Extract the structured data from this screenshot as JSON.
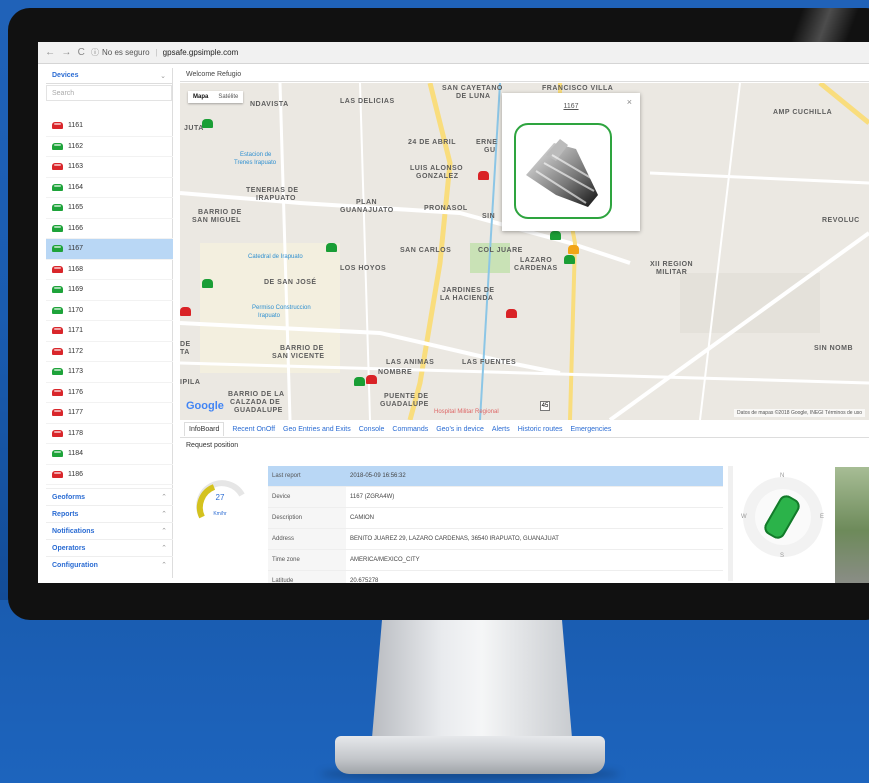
{
  "browser": {
    "security": "No es seguro",
    "url": "gpsafe.gpsimple.com"
  },
  "sidebar": {
    "devices_label": "Devices",
    "search_placeholder": "Search",
    "devices": [
      {
        "id": "1161",
        "status": "red"
      },
      {
        "id": "1162",
        "status": "green"
      },
      {
        "id": "1163",
        "status": "red"
      },
      {
        "id": "1164",
        "status": "green"
      },
      {
        "id": "1165",
        "status": "green"
      },
      {
        "id": "1166",
        "status": "green"
      },
      {
        "id": "1167",
        "status": "green",
        "selected": true
      },
      {
        "id": "1168",
        "status": "red"
      },
      {
        "id": "1169",
        "status": "green"
      },
      {
        "id": "1170",
        "status": "green"
      },
      {
        "id": "1171",
        "status": "red"
      },
      {
        "id": "1172",
        "status": "red"
      },
      {
        "id": "1173",
        "status": "green"
      },
      {
        "id": "1176",
        "status": "red"
      },
      {
        "id": "1177",
        "status": "red"
      },
      {
        "id": "1178",
        "status": "red"
      },
      {
        "id": "1184",
        "status": "green"
      },
      {
        "id": "1186",
        "status": "red"
      }
    ],
    "menu": [
      "Geoforms",
      "Reports",
      "Notifications",
      "Operators",
      "Configuration"
    ]
  },
  "header": {
    "welcome": "Welcome Refugio"
  },
  "map": {
    "type_buttons": {
      "map": "Mapa",
      "satellite": "Satélite"
    },
    "popup_title": "1167",
    "popup_close": "×",
    "labels": {
      "andavista": "NDAVISTA",
      "las_delicias": "LAS DELICIAS",
      "san_cayetano": "SAN CAYETANO",
      "de_luna": "DE LUNA",
      "francisco_villa": "FRANCISCO VILLA",
      "amp_cuchilla": "AMP CUCHILLA",
      "juta": "JUTA",
      "abril": "24 DE ABRIL",
      "erne": "ERNE",
      "gu": "GU",
      "luis_alonso": "LUIS ALONSO",
      "gonzalez": "GONZALEZ",
      "tenerias": "TENERIAS DE",
      "irapuato": "IRAPUATO",
      "plan": "PLAN",
      "guanajuato": "GUANAJUATO",
      "pronasol": "PRONASOL",
      "sin": "SIN",
      "barrio_san_miguel_1": "BARRIO DE",
      "barrio_san_miguel_2": "SAN MIGUEL",
      "revoluc": "REVOLUC",
      "san_carlos": "SAN CARLOS",
      "col_juare": "COL JUARE",
      "lazaro": "LAZARO",
      "cardenas": "CARDENAS",
      "los_hoyos": "LOS HOYOS",
      "de_san_jose": "DE SAN JOSÉ",
      "xii_region": "XII REGION",
      "militar": "MILITAR",
      "jardines": "JARDINES DE",
      "hacienda": "LA HACIENDA",
      "de": "DE",
      "ta": "TA",
      "barrio_san_vicente_1": "BARRIO DE",
      "barrio_san_vicente_2": "SAN VICENTE",
      "sin_nomb": "SIN NOMB",
      "las_animas": "LAS ANIMAS",
      "las_fuentes": "LAS FUENTES",
      "nombre": "NOMBRE",
      "ipila": "IPILA",
      "calzada_1": "BARRIO DE LA",
      "calzada_2": "CALZADA DE",
      "calzada_3": "GUADALUPE",
      "puente_1": "PUENTE DE",
      "puente_2": "GUADALUPE"
    },
    "pois": {
      "estacion_1": "Estacion de",
      "estacion_2": "Trenes Irapuato",
      "catedral": "Catedral de Irapuato",
      "permiso_1": "Permiso Construccion",
      "permiso_2": "Irapuato",
      "hospital": "Hospital Militar Regional"
    },
    "google": "Google",
    "attribution": "Datos de mapas ©2018 Google, INEGI   Términos de uso",
    "route": "45"
  },
  "bottom": {
    "tabs": [
      "InfoBoard",
      "Recent OnOff",
      "Geo Entries and Exits",
      "Console",
      "Commands",
      "Geo's in device",
      "Alerts",
      "Historic routes",
      "Emergencies"
    ],
    "request_position": "Request position",
    "gauge": {
      "value": "27",
      "unit": "Km/hr"
    },
    "info": [
      {
        "k": "Last report",
        "v": "2018-05-09 16:56:32"
      },
      {
        "k": "Device",
        "v": "1167 (ZGRA4W)"
      },
      {
        "k": "Description",
        "v": "CAMION"
      },
      {
        "k": "Address",
        "v": "BENITO JUAREZ 29, LAZARO CARDENAS, 36540 IRAPUATO, GUANAJUAT"
      },
      {
        "k": "Time zone",
        "v": "AMERICA/MEXICO_CITY"
      },
      {
        "k": "Latitude",
        "v": "20.675278"
      }
    ],
    "compass": {
      "n": "N",
      "e": "E",
      "s": "S",
      "w": "W"
    }
  },
  "colors": {
    "accent": "#2b6cd3",
    "selected": "#b9d7f5",
    "green": "#1ea33a",
    "red": "#d9262b",
    "background": "#1a5cb0"
  }
}
